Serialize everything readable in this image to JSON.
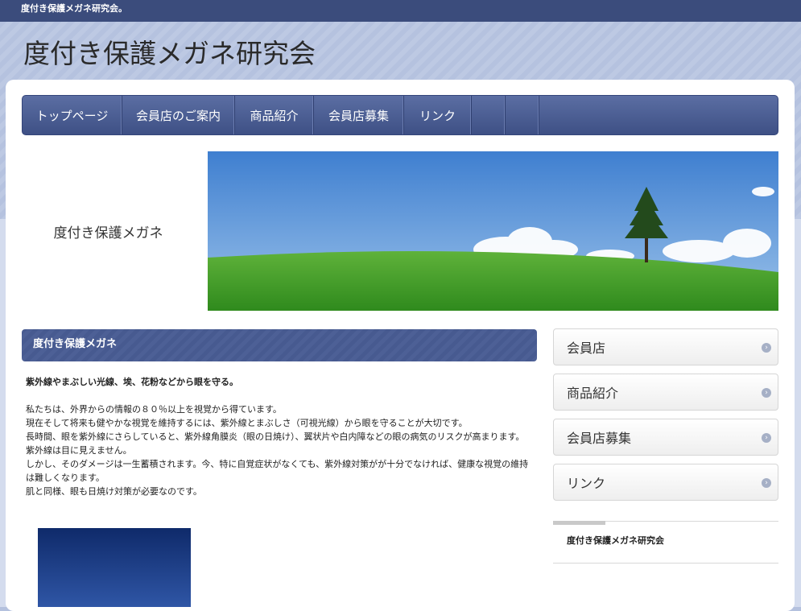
{
  "topbar": {
    "text": "度付き保護メガネ研究会。"
  },
  "header": {
    "site_title": "度付き保護メガネ研究会"
  },
  "nav": {
    "items": [
      {
        "label": "トップページ"
      },
      {
        "label": "会員店のご案内"
      },
      {
        "label": "商品紹介"
      },
      {
        "label": "会員店募集"
      },
      {
        "label": "リンク"
      },
      {
        "label": ""
      },
      {
        "label": ""
      }
    ]
  },
  "hero": {
    "label": "度付き保護メガネ",
    "image": "landscape-tree-image"
  },
  "main": {
    "section_title": "度付き保護メガネ",
    "lead": "紫外線やまぶしい光線、埃、花粉などから眼を守る。",
    "paragraphs": [
      "私たちは、外界からの情報の８０％以上を視覚から得ています。",
      "現在そして将来も健やかな視覚を維持するには、紫外線とまぶしさ（可視光線）から眼を守ることが大切です。",
      "長時間、眼を紫外線にさらしていると、紫外線角膜炎（眼の日焼け）、翼状片や白内障などの眼の病気のリスクが高まります。",
      "紫外線は目に見えません。",
      "しかし、そのダメージは一生蓄積されます。今、特に自覚症状がなくても、紫外線対策がが十分でなければ、健康な視覚の維持は難しくなります。",
      "肌と同様、眼も日焼け対策が必要なのです。"
    ]
  },
  "sidebar": {
    "buttons": [
      {
        "label": "会員店"
      },
      {
        "label": "商品紹介"
      },
      {
        "label": "会員店募集"
      },
      {
        "label": "リンク"
      }
    ],
    "widget_title": "度付き保護メガネ研究会"
  },
  "colors": {
    "topbar": "#3b4c7c",
    "nav": "#4a5c92",
    "header_band": "#b5c2df",
    "section_head": "#475a90"
  }
}
